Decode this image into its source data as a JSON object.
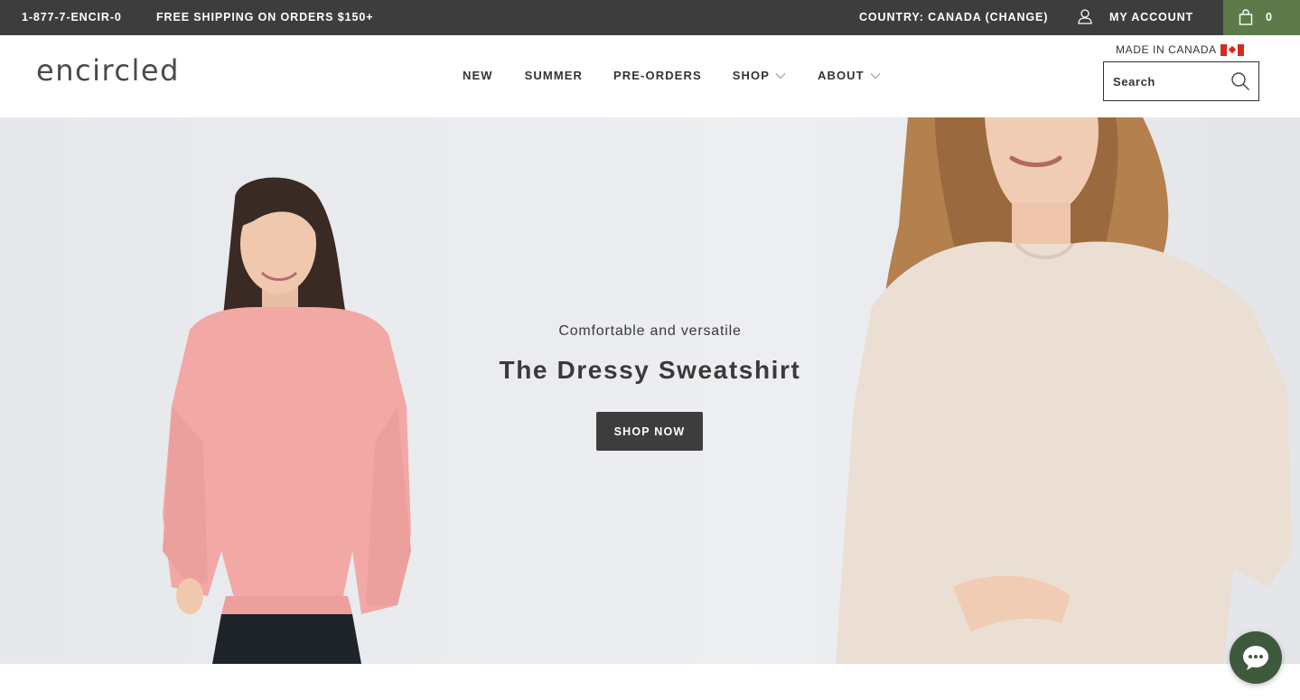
{
  "topbar": {
    "phone": "1-877-7-ENCIR-0",
    "shipping": "FREE SHIPPING ON ORDERS $150+",
    "country": "COUNTRY: CANADA (CHANGE)",
    "account_icon": "user-icon",
    "account": "MY ACCOUNT",
    "cart_icon": "shopping-bag-icon",
    "cart_count": "0"
  },
  "header": {
    "logo": "encircled",
    "nav": [
      {
        "label": "NEW"
      },
      {
        "label": "SUMMER"
      },
      {
        "label": "PRE-ORDERS"
      },
      {
        "label": "SHOP"
      },
      {
        "label": "ABOUT"
      }
    ],
    "made_in": "MADE IN CANADA",
    "flag_icon": "canada-flag-icon",
    "search_placeholder": "Search",
    "search_icon": "search-icon"
  },
  "hero": {
    "subtitle": "Comfortable and versatile",
    "title": "The Dressy Sweatshirt",
    "button": "SHOP NOW"
  },
  "chat": {
    "icon": "chat-bubble-icon"
  },
  "colors": {
    "topbar_bg": "#3d3d3d",
    "cart_bg": "#5e7a4a",
    "button_bg": "#3d3d3d",
    "chat_bg": "#3d5a3c",
    "left_model_shirt": "#f2a8a4",
    "right_model_shirt": "#eadfd2"
  }
}
